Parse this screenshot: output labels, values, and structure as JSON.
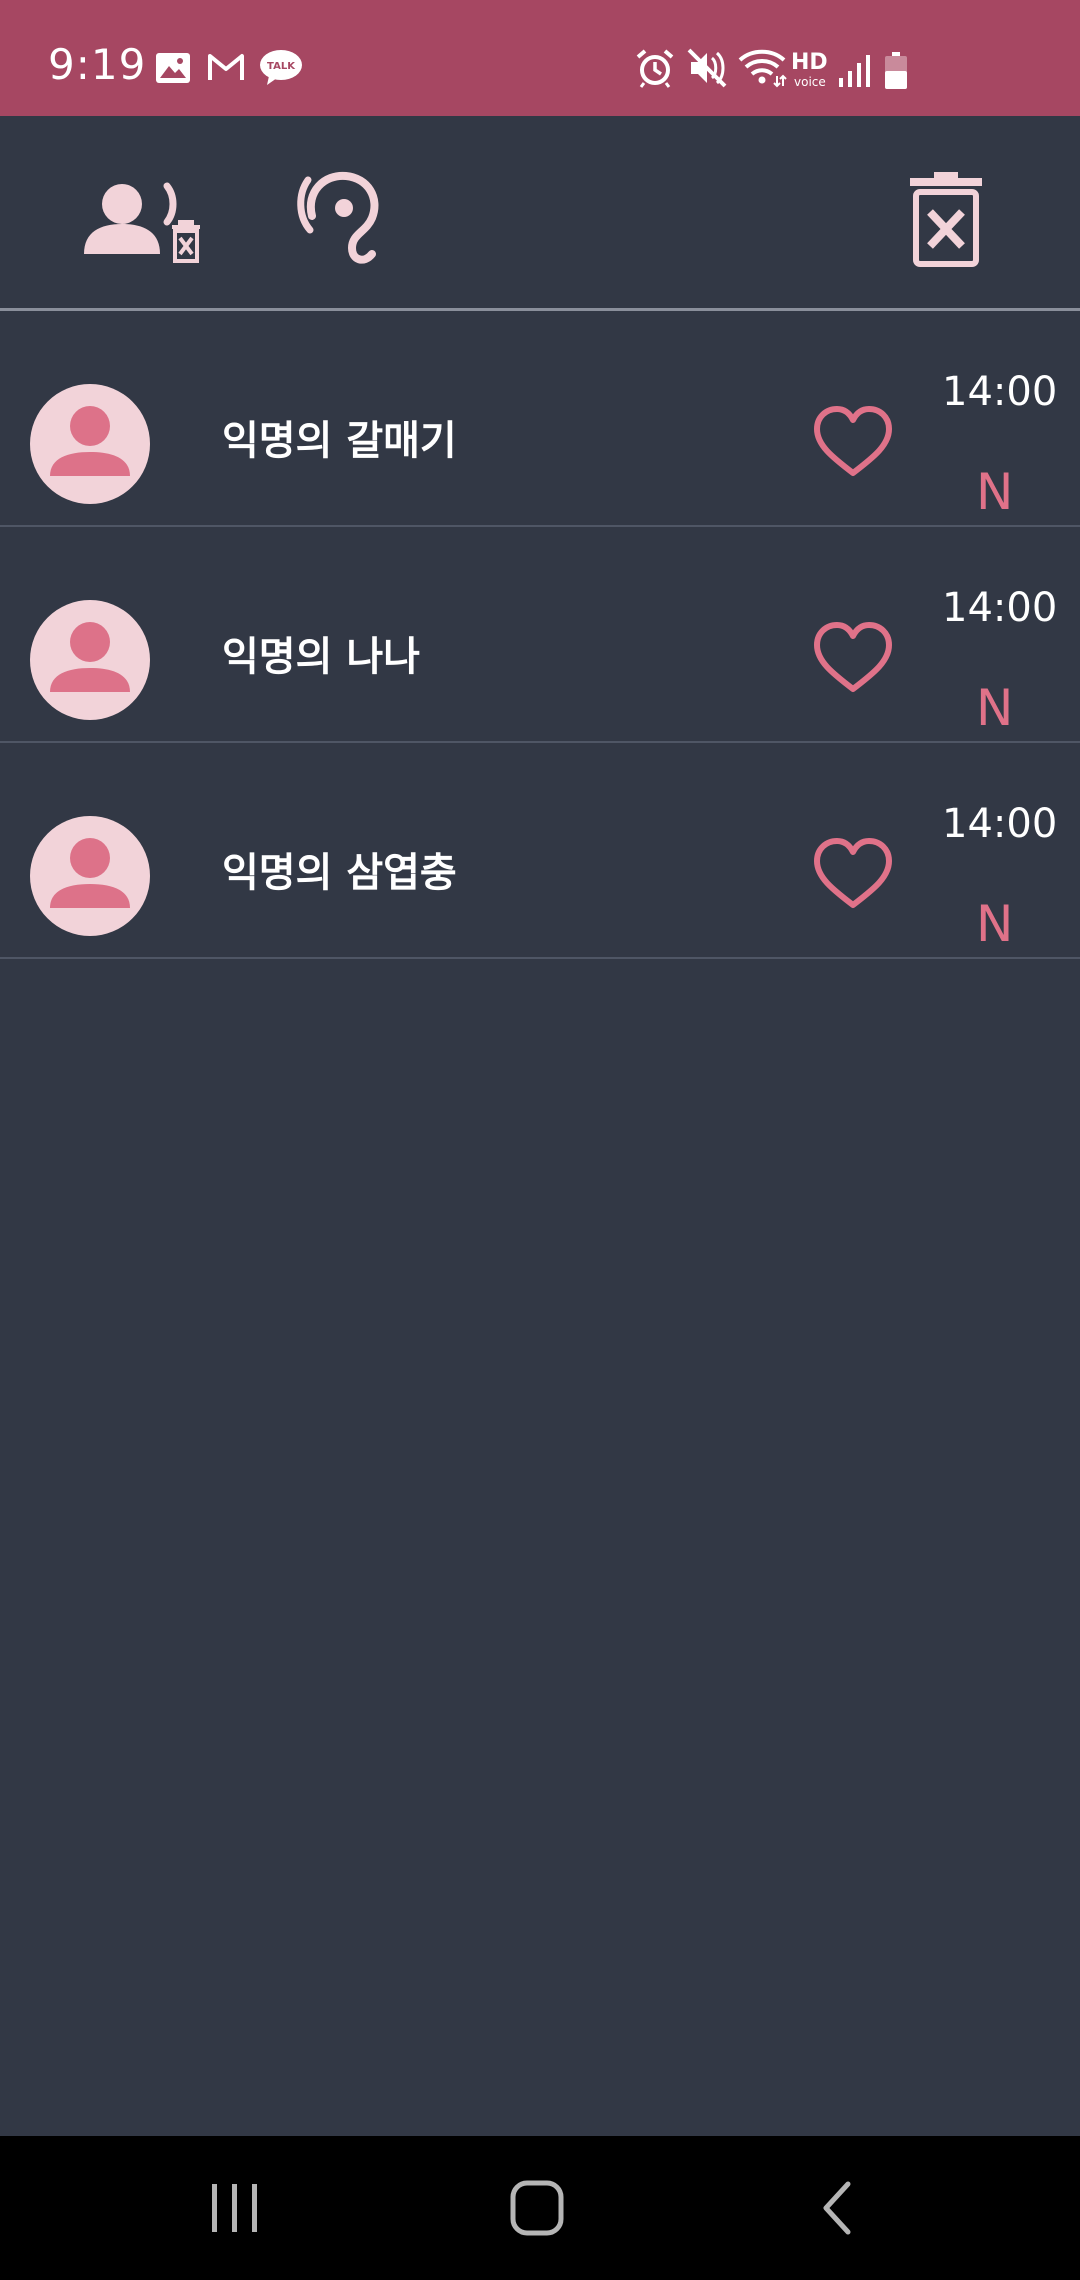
{
  "status_bar": {
    "time": "9:19",
    "hd": "HD",
    "voice": "voice",
    "left_icons": [
      "image-icon",
      "gmail-icon",
      "talk-icon"
    ],
    "right_icons": [
      "alarm-icon",
      "mute-icon",
      "wifi-icon",
      "signal-icon",
      "battery-icon"
    ],
    "talk_label": "TALK"
  },
  "toolbar": {
    "icons": [
      "delete-contact-icon",
      "listen-ear-icon",
      "delete-all-icon"
    ]
  },
  "contacts": [
    {
      "name": "익명의 갈매기",
      "time": "14:00",
      "badge": "N"
    },
    {
      "name": "익명의 나나",
      "time": "14:00",
      "badge": "N"
    },
    {
      "name": "익명의 삼엽충",
      "time": "14:00",
      "badge": "N"
    }
  ],
  "colors": {
    "accent": "#a64762",
    "background": "#323845",
    "pink": "#e07289",
    "light_pink": "#f2d3d9"
  }
}
